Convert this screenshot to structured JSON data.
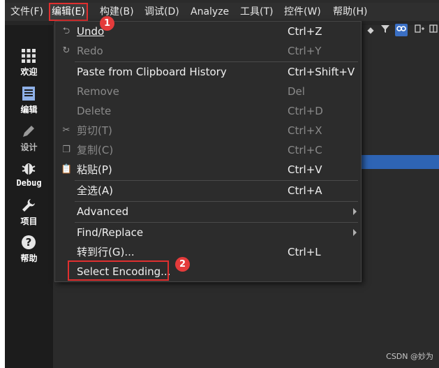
{
  "menubar": {
    "items": [
      {
        "label": "文件(F)"
      },
      {
        "label": "编辑(E)"
      },
      {
        "label": "构建(B)"
      },
      {
        "label": "调试(D)"
      },
      {
        "label": "Analyze"
      },
      {
        "label": "工具(T)"
      },
      {
        "label": "控件(W)"
      },
      {
        "label": "帮助(H)"
      }
    ]
  },
  "sidebar": {
    "items": [
      {
        "label": "欢迎",
        "icon": "grid-icon"
      },
      {
        "label": "编辑",
        "icon": "document-icon"
      },
      {
        "label": "设计",
        "icon": "pencil-icon"
      },
      {
        "label": "Debug",
        "icon": "bug-icon"
      },
      {
        "label": "项目",
        "icon": "wrench-icon"
      },
      {
        "label": "帮助",
        "icon": "question-icon"
      }
    ]
  },
  "edit_menu": {
    "items": [
      {
        "label": "Undo",
        "shortcut": "Ctrl+Z",
        "icon": "undo-icon",
        "enabled": true
      },
      {
        "label": "Redo",
        "shortcut": "Ctrl+Y",
        "icon": "redo-icon",
        "enabled": false
      },
      {
        "label": "Paste from Clipboard History",
        "shortcut": "Ctrl+Shift+V",
        "enabled": true
      },
      {
        "label": "Remove",
        "shortcut": "Del",
        "enabled": false
      },
      {
        "label": "Delete",
        "shortcut": "Ctrl+D",
        "enabled": false
      },
      {
        "label": "剪切(T)",
        "shortcut": "Ctrl+X",
        "icon": "scissors-icon",
        "enabled": false
      },
      {
        "label": "复制(C)",
        "shortcut": "Ctrl+C",
        "icon": "copy-icon",
        "enabled": false
      },
      {
        "label": "粘贴(P)",
        "shortcut": "Ctrl+V",
        "icon": "paste-icon",
        "enabled": true
      },
      {
        "label": "全选(A)",
        "shortcut": "Ctrl+A",
        "enabled": true
      },
      {
        "label": "Advanced",
        "shortcut": "",
        "submenu": true,
        "enabled": true
      },
      {
        "label": "Find/Replace",
        "shortcut": "",
        "submenu": true,
        "enabled": true
      },
      {
        "label": "转到行(G)...",
        "shortcut": "Ctrl+L",
        "enabled": true
      },
      {
        "label": "Select Encoding...",
        "shortcut": "",
        "enabled": true
      }
    ]
  },
  "annotations": {
    "badge1": "1",
    "badge2": "2"
  },
  "watermark": "CSDN @妙为",
  "colors": {
    "accent_red": "#e02f2f",
    "selection_blue": "#2e64b4"
  }
}
